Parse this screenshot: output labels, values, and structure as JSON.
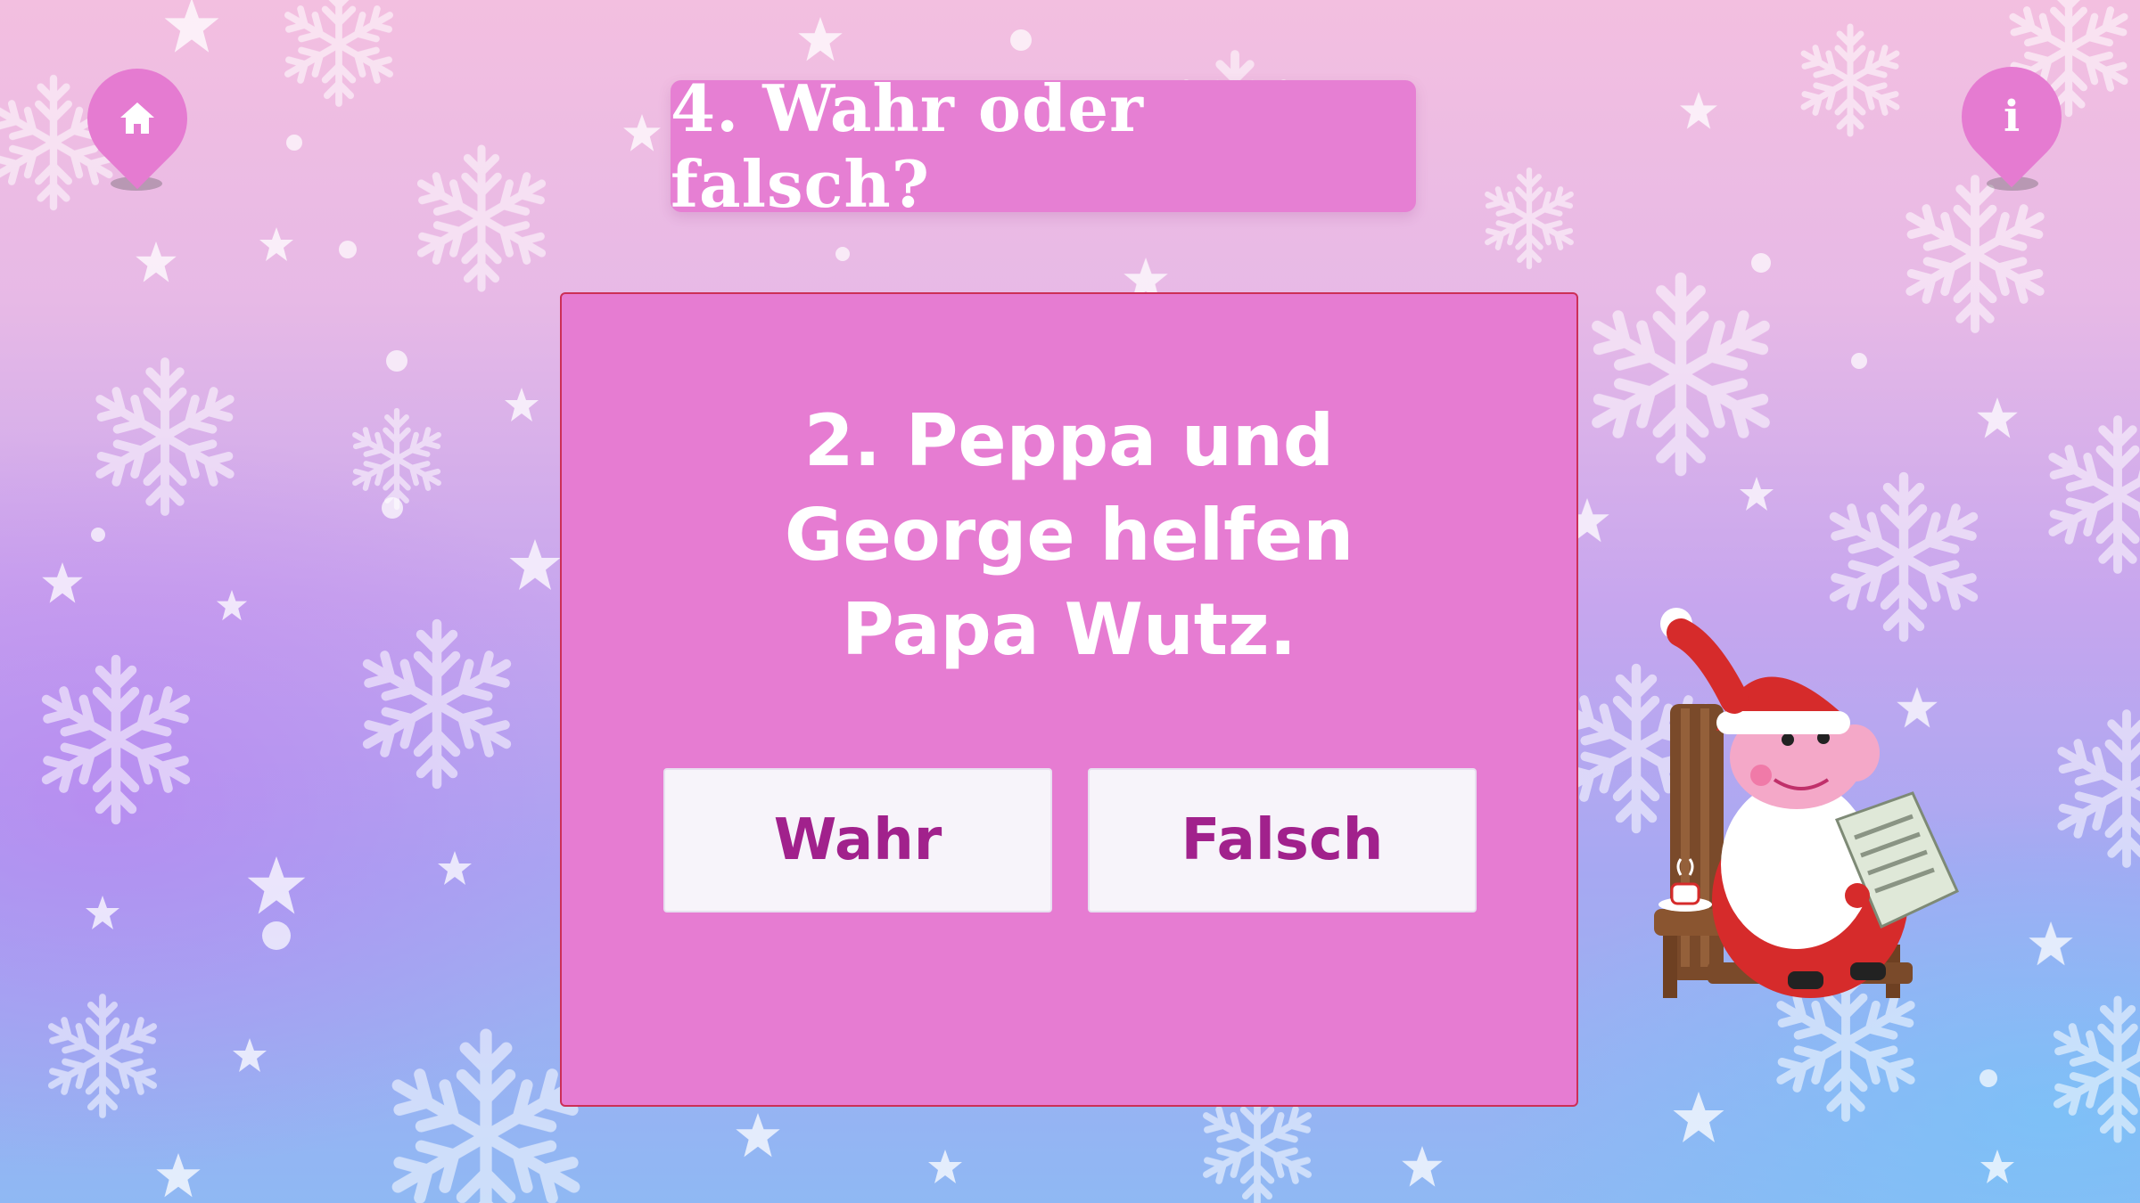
{
  "header": {
    "title": "4. Wahr oder falsch?"
  },
  "nav": {
    "home_icon": "home-icon",
    "info_icon": "info-icon",
    "info_glyph": "i"
  },
  "quiz": {
    "question_lines": [
      "2. Peppa und",
      "George helfen",
      "Papa Wutz."
    ],
    "answers": [
      {
        "label": "Wahr"
      },
      {
        "label": "Falsch"
      }
    ]
  },
  "colors": {
    "accent_pink": "#e67cd2",
    "card_border": "#cc2f57",
    "button_text": "#a1218c",
    "button_bg": "#f7f4fa"
  },
  "decoration": {
    "illustration": "santa-pig-reading-newspaper"
  }
}
